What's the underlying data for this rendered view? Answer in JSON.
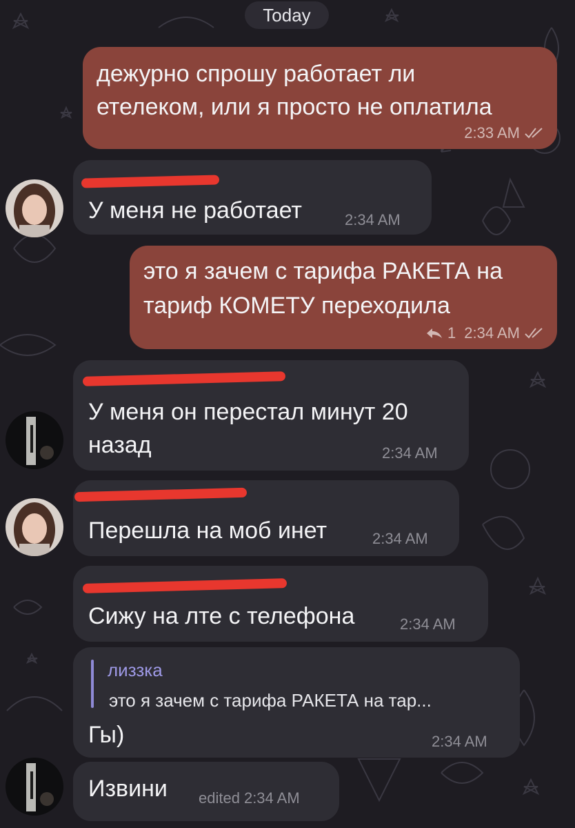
{
  "date_separator": "Today",
  "messages": [
    {
      "lines": [
        "дежурно спрошу работает ли",
        "етелеком, или я просто не оплатила"
      ],
      "time": "2:33 AM"
    },
    {
      "text": "У меня не работает",
      "time": "2:34 AM"
    },
    {
      "lines": [
        "это я зачем с тарифа РАКЕТА на",
        "тариф КОМЕТУ переходила"
      ],
      "replies": "1",
      "time": "2:34 AM"
    },
    {
      "lines": [
        "У меня он перестал минут 20",
        "назад"
      ],
      "time": "2:34 AM"
    },
    {
      "text": "Перешла на моб инет",
      "time": "2:34 AM"
    },
    {
      "text": "Сижу на лте с телефона",
      "time": "2:34 AM"
    },
    {
      "reply_author": "лиззка",
      "reply_quote": "это я зачем с тарифа РАКЕТА на тар...",
      "text": "Гы)",
      "time": "2:34 AM"
    },
    {
      "text": "Извини",
      "edited": "edited",
      "time": "2:34 AM"
    }
  ],
  "colors": {
    "outgoing_bubble": "#8a443b",
    "incoming_bubble": "#2e2d34",
    "background": "#1e1c22",
    "reply_accent": "#9e99e6",
    "redaction": "#e8372e"
  },
  "icons": [
    "double-check-icon",
    "reply-arrow-icon",
    "avatar-girl",
    "avatar-dark-photo"
  ]
}
